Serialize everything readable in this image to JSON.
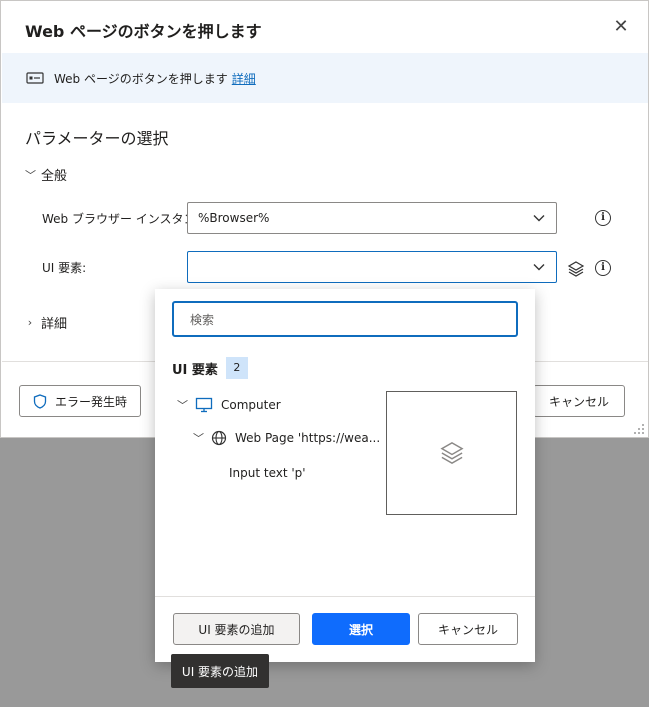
{
  "dialog": {
    "title": "Web ページのボタンを押します",
    "info_text": "Web ページのボタンを押します",
    "info_link": "詳細",
    "section_title": "パラメーターの選択",
    "general_group": "全般",
    "browser_label": "Web ブラウザー インスタンス:",
    "browser_value": "%Browser%",
    "ui_element_label": "UI 要素:",
    "ui_element_value": "",
    "advanced_group": "詳細",
    "on_error_label": "エラー発生時",
    "cancel_label": "キャンセル"
  },
  "picker": {
    "search_placeholder": "検索",
    "heading": "UI 要素",
    "count": "2",
    "tree": {
      "computer": "Computer",
      "web_page": "Web Page 'https://wea...",
      "input": "Input text 'p'"
    },
    "add_element_label": "UI 要素の追加",
    "select_label": "選択",
    "cancel_label": "キャンセル"
  },
  "tooltip": "UI 要素の追加",
  "colors": {
    "accent": "#0f6cbd",
    "primary_button": "#0f6cfd",
    "info_bar": "#eff5fc",
    "overlay": "#999999"
  }
}
